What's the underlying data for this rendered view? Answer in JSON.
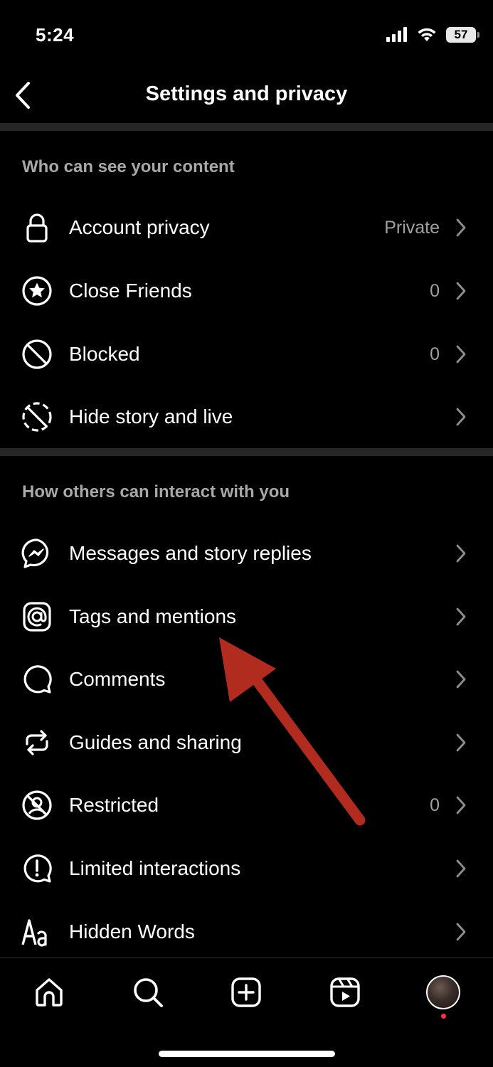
{
  "status_bar": {
    "time": "5:24",
    "battery": "57"
  },
  "nav": {
    "title": "Settings and privacy"
  },
  "sections": [
    {
      "header": "Who can see your content",
      "items": [
        {
          "label": "Account privacy",
          "value": "Private",
          "icon": "lock-icon"
        },
        {
          "label": "Close Friends",
          "value": "0",
          "icon": "star-circle-icon"
        },
        {
          "label": "Blocked",
          "value": "0",
          "icon": "blocked-icon"
        },
        {
          "label": "Hide story and live",
          "value": "",
          "icon": "hide-story-icon"
        }
      ]
    },
    {
      "header": "How others can interact with you",
      "items": [
        {
          "label": "Messages and story replies",
          "value": "",
          "icon": "messenger-icon"
        },
        {
          "label": "Tags and mentions",
          "value": "",
          "icon": "at-sign-icon"
        },
        {
          "label": "Comments",
          "value": "",
          "icon": "comment-icon"
        },
        {
          "label": "Guides and sharing",
          "value": "",
          "icon": "share-loop-icon"
        },
        {
          "label": "Restricted",
          "value": "0",
          "icon": "restricted-icon"
        },
        {
          "label": "Limited interactions",
          "value": "",
          "icon": "limited-interactions-icon"
        },
        {
          "label": "Hidden Words",
          "value": "",
          "icon": "hidden-words-icon"
        }
      ]
    }
  ],
  "tab_bar": {
    "tabs": [
      "home-icon",
      "search-icon",
      "create-icon",
      "reels-icon",
      "profile-avatar"
    ]
  },
  "annotation": {
    "color": "#b12b1e"
  }
}
